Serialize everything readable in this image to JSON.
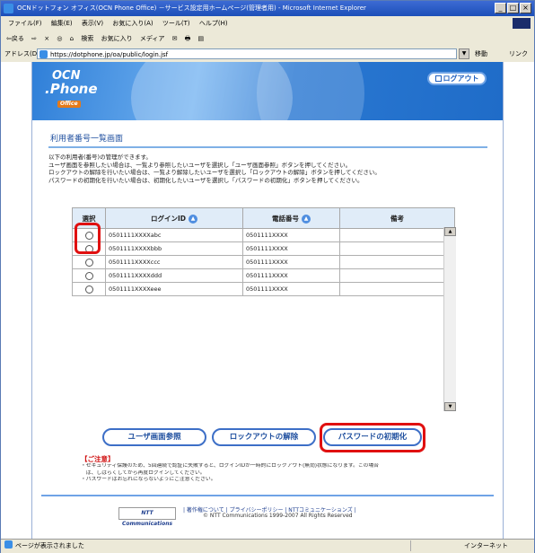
{
  "window": {
    "title": "OCNドットフォン オフィス(OCN Phone Office) －サービス設定用ホームページ(管理者用) - Microsoft Internet Explorer",
    "buttons": [
      "_",
      "□",
      "×"
    ]
  },
  "menu": [
    "ファイル(F)",
    "編集(E)",
    "表示(V)",
    "お気に入り(A)",
    "ツール(T)",
    "ヘルプ(H)"
  ],
  "toolbar": [
    "⇦戻る",
    "⇨",
    "×",
    "◎",
    "⌂",
    "検索",
    "お気に入り",
    "メディア",
    "✉",
    "🖶",
    "▤"
  ],
  "address": {
    "label": "アドレス(D)",
    "url": "https://dotphone.jp/oa/public/login.jsf",
    "go": "移動",
    "links": "リンク"
  },
  "logo": {
    "line1": "OCN",
    "line2": ".Phone",
    "line3": "Office"
  },
  "logout_label": "ログアウト",
  "page_title": "利用者番号一覧画面",
  "description": [
    "以下の利用者(番号)の管理ができます。",
    "ユーザ画面を参照したい場合は、一覧より参照したいユーザを選択し「ユーザ画面参照」ボタンを押してください。",
    "ロックアウトの解除を行いたい場合は、一覧より解除したいユーザを選択し「ロックアウトの解除」ボタンを押してください。",
    "パスワードの初期化を行いたい場合は、初期化したいユーザを選択し「パスワードの初期化」ボタンを押してください。"
  ],
  "table": {
    "headers": [
      "選択",
      "ログインID",
      "電話番号",
      "備考"
    ],
    "rows": [
      {
        "login_id": "0501111XXXXabc",
        "phone": "0501111XXXX",
        "note": ""
      },
      {
        "login_id": "0501111XXXXbbb",
        "phone": "0501111XXXX",
        "note": ""
      },
      {
        "login_id": "0501111XXXXccc",
        "phone": "0501111XXXX",
        "note": ""
      },
      {
        "login_id": "0501111XXXXddd",
        "phone": "0501111XXXX",
        "note": ""
      },
      {
        "login_id": "0501111XXXXeee",
        "phone": "0501111XXXX",
        "note": ""
      }
    ]
  },
  "buttons": {
    "user_view": "ユーザ画面参照",
    "unlock": "ロックアウトの解除",
    "reset_password": "パスワードの初期化"
  },
  "notes": {
    "title": "【ご注意】",
    "lines": [
      "・セキュリティ保護のため、5回連続で認証に失敗すると、ログインIDが一時的にロックアウト(無効)状態になります。この場合",
      "　は、しばらくしてから再度ログインしてください。",
      "・パスワードはお忘れにならないようにご注意ください。"
    ]
  },
  "footer": {
    "ntt_logo": "NTT Communications",
    "links": "| 著作権について | プライバシーポリシー | NTTコミュニケーションズ |",
    "copyright": "© NTT Communications 1999-2007 All Rights Reserved"
  },
  "status": {
    "text": "ページが表示されました",
    "zone": "インターネット"
  },
  "colors": {
    "accent": "#3d6fc7",
    "highlight": "#e01010",
    "heading": "#1f4f9f"
  }
}
